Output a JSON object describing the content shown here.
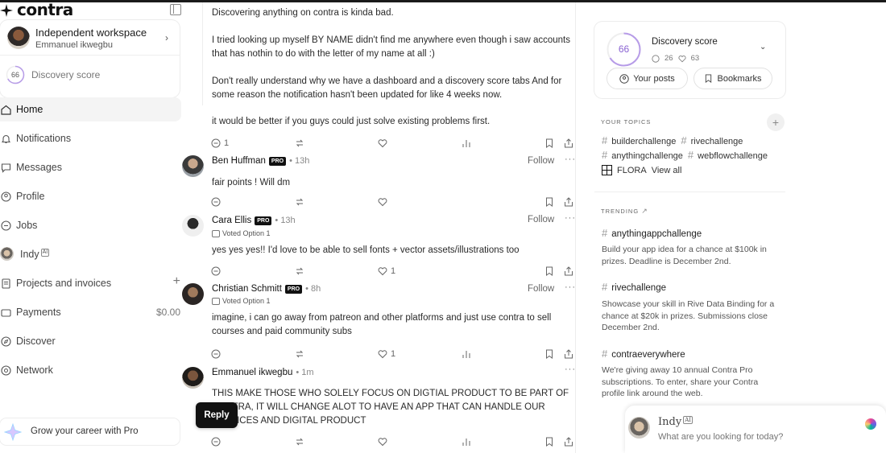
{
  "app": {
    "logo_text": "contra"
  },
  "workspace": {
    "title": "Independent workspace",
    "user": "Emmanuel ikwegbu"
  },
  "discovery_sidebar": {
    "score": "66",
    "label": "Discovery score"
  },
  "nav": {
    "home": "Home",
    "notifications": "Notifications",
    "messages": "Messages",
    "profile": "Profile",
    "jobs": "Jobs",
    "indy": "Indy",
    "indy_badge": "AI",
    "projects": "Projects and invoices",
    "payments": "Payments",
    "payments_value": "$0.00",
    "discover": "Discover",
    "network": "Network"
  },
  "pro_promo": "Grow your career with Pro",
  "post": {
    "paragraphs": [
      "Discovering anything on contra is kinda bad.",
      "I tried looking up myself BY NAME didn't find me anywhere even though i saw accounts that has nothin to do with the letter of my name at all :)",
      "Don't really understand why we have a dashboard and a discovery score tabs And for some reason the notification hasn't been updated for like 4 weeks now.",
      "it would be better if you guys could just solve existing problems first."
    ],
    "comment_count": "1"
  },
  "comments": [
    {
      "name": "Ben Huffman",
      "pro": "PRO",
      "time": "13h",
      "follow": "Follow",
      "voted": "",
      "body": "fair points ! Will dm",
      "likes": ""
    },
    {
      "name": "Cara Ellis",
      "pro": "PRO",
      "time": "13h",
      "follow": "Follow",
      "voted": "Voted Option 1",
      "body": "yes yes yes!! I'd love to be able to sell fonts + vector assets/illustrations too",
      "likes": "1"
    },
    {
      "name": "Christian Schmitt",
      "pro": "PRO",
      "time": "8h",
      "follow": "Follow",
      "voted": "Voted Option 1",
      "body": "imagine, i can go away from patreon and other platforms and just use contra to sell courses and paid community subs",
      "likes": "1"
    },
    {
      "name": "Emmanuel ikwegbu",
      "pro": "",
      "time": "1m",
      "follow": "",
      "voted": "",
      "body": "THIS MAKE THOSE WHO SOLELY FOCUS ON DIGTIAL PRODUCT TO BE PART OF CONTRA, IT WILL CHANGE ALOT TO HAVE AN APP THAT CAN HANDLE OUR SERVICES AND DIGITAL PRODUCT",
      "likes": ""
    }
  ],
  "reply_button": "Reply",
  "discovery_card": {
    "score": "66",
    "title": "Discovery score",
    "stat_a": "26",
    "stat_b": "63",
    "your_posts": "Your posts",
    "bookmarks": "Bookmarks"
  },
  "topics": {
    "title": "YOUR TOPICS",
    "items": [
      "builderchallenge",
      "rivechallenge",
      "anythingchallenge",
      "webflowchallenge"
    ],
    "flora": "FLORA",
    "view_all": "View all"
  },
  "trending": {
    "title": "TRENDING",
    "items": [
      {
        "tag": "anythingappchallenge",
        "desc": "Build your app idea for a chance at $100k in prizes. Deadline is December 2nd."
      },
      {
        "tag": "rivechallenge",
        "desc": "Showcase your skill in Rive Data Binding for a chance at $20k in prizes. Submissions close December 2nd."
      },
      {
        "tag": "contraeverywhere",
        "desc": "We're giving away 10 annual Contra Pro subscriptions. To enter, share your Contra profile link around the web."
      }
    ]
  },
  "indy_chat": {
    "title": "Indy",
    "badge": "AI",
    "placeholder": "What are you looking for today?"
  },
  "colors": {
    "accent": "#8a63d2",
    "ink": "#111111",
    "muted": "#777777",
    "border": "#ececec"
  }
}
